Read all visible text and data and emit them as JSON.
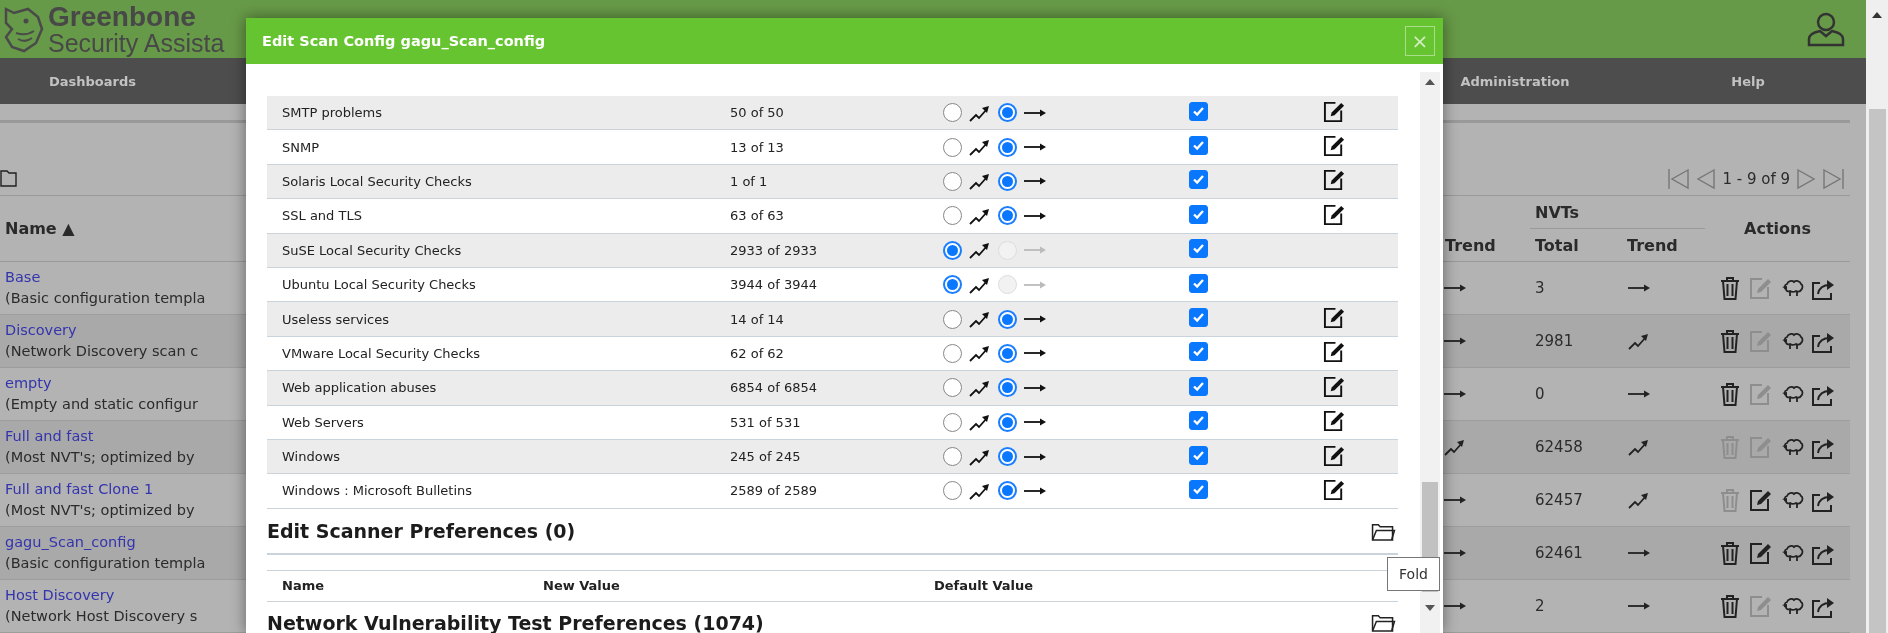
{
  "header": {
    "logo_line_1": "Greenbone",
    "logo_line_2": "Security Assista"
  },
  "nav": [
    {
      "label": "Dashboards"
    },
    {
      "label": "Administration"
    },
    {
      "label": "Help"
    }
  ],
  "pagination": "1 - 9 of 9",
  "table": {
    "columns": {
      "name": "Name ▲",
      "family_trend": "Trend",
      "nvts": "NVTs",
      "nvt_total": "Total",
      "nvt_trend": "Trend",
      "actions": "Actions"
    },
    "rows": [
      {
        "name": "Base",
        "description": "(Basic configuration templa",
        "family_trend_dynamic": false,
        "nvt_total": "3",
        "nvt_trend_dynamic": false,
        "delete_disabled": false,
        "edit_disabled": true
      },
      {
        "name": "Discovery",
        "description": "(Network Discovery scan c",
        "family_trend_dynamic": false,
        "nvt_total": "2981",
        "nvt_trend_dynamic": true,
        "delete_disabled": false,
        "edit_disabled": true
      },
      {
        "name": "empty",
        "description": "(Empty and static configur",
        "family_trend_dynamic": false,
        "nvt_total": "0",
        "nvt_trend_dynamic": false,
        "delete_disabled": false,
        "edit_disabled": true
      },
      {
        "name": "Full and fast",
        "description": "(Most NVT's; optimized by",
        "family_trend_dynamic": true,
        "nvt_total": "62458",
        "nvt_trend_dynamic": true,
        "delete_disabled": true,
        "edit_disabled": true
      },
      {
        "name": "Full and fast Clone 1",
        "description": "(Most NVT's; optimized by",
        "family_trend_dynamic": false,
        "nvt_total": "62457",
        "nvt_trend_dynamic": true,
        "delete_disabled": true,
        "edit_disabled": false
      },
      {
        "name": "gagu_Scan_config",
        "description": "(Basic configuration templa",
        "family_trend_dynamic": false,
        "nvt_total": "62461",
        "nvt_trend_dynamic": false,
        "delete_disabled": false,
        "edit_disabled": false
      },
      {
        "name": "Host Discovery",
        "description": "(Network Host Discovery s",
        "family_trend_dynamic": false,
        "nvt_total": "2",
        "nvt_trend_dynamic": false,
        "delete_disabled": false,
        "edit_disabled": true
      }
    ]
  },
  "dialog": {
    "title": "Edit Scan Config gagu_Scan_config",
    "close_label": "×",
    "families": [
      {
        "name": "SMTP problems",
        "nvts": "50 of 50",
        "dynamic": false,
        "static_disabled": false,
        "checked": true,
        "editable": true
      },
      {
        "name": "SNMP",
        "nvts": "13 of 13",
        "dynamic": false,
        "static_disabled": false,
        "checked": true,
        "editable": true
      },
      {
        "name": "Solaris Local Security Checks",
        "nvts": "1 of 1",
        "dynamic": false,
        "static_disabled": false,
        "checked": true,
        "editable": true
      },
      {
        "name": "SSL and TLS",
        "nvts": "63 of 63",
        "dynamic": false,
        "static_disabled": false,
        "checked": true,
        "editable": true
      },
      {
        "name": "SuSE Local Security Checks",
        "nvts": "2933 of 2933",
        "dynamic": true,
        "static_disabled": true,
        "checked": true,
        "editable": false
      },
      {
        "name": "Ubuntu Local Security Checks",
        "nvts": "3944 of 3944",
        "dynamic": true,
        "static_disabled": true,
        "checked": true,
        "editable": false
      },
      {
        "name": "Useless services",
        "nvts": "14 of 14",
        "dynamic": false,
        "static_disabled": false,
        "checked": true,
        "editable": true
      },
      {
        "name": "VMware Local Security Checks",
        "nvts": "62 of 62",
        "dynamic": false,
        "static_disabled": false,
        "checked": true,
        "editable": true
      },
      {
        "name": "Web application abuses",
        "nvts": "6854 of 6854",
        "dynamic": false,
        "static_disabled": false,
        "checked": true,
        "editable": true
      },
      {
        "name": "Web Servers",
        "nvts": "531 of 531",
        "dynamic": false,
        "static_disabled": false,
        "checked": true,
        "editable": true
      },
      {
        "name": "Windows",
        "nvts": "245 of 245",
        "dynamic": false,
        "static_disabled": false,
        "checked": true,
        "editable": true
      },
      {
        "name": "Windows : Microsoft Bulletins",
        "nvts": "2589 of 2589",
        "dynamic": false,
        "static_disabled": false,
        "checked": true,
        "editable": true
      }
    ],
    "scanner_preferences": {
      "title": "Edit Scanner Preferences (0)",
      "columns": [
        "Name",
        "New Value",
        "Default Value"
      ]
    },
    "nvt_preferences": {
      "title": "Network Vulnerability Test Preferences (1074)"
    },
    "tooltip": "Fold"
  }
}
